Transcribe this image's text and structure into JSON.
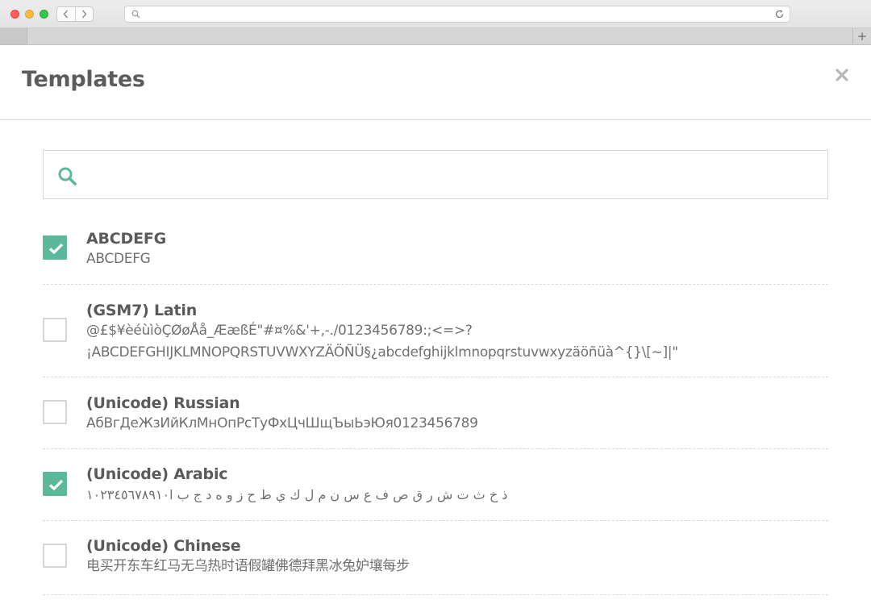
{
  "browser": {
    "back_icon": "chevron-left-icon",
    "forward_icon": "chevron-right-icon",
    "url_value": "",
    "new_tab_label": "+"
  },
  "modal": {
    "title": "Templates",
    "close_icon": "close-icon",
    "search": {
      "icon": "search-icon",
      "value": "",
      "placeholder": ""
    }
  },
  "templates": [
    {
      "name": "ABCDEFG",
      "checked": true,
      "lines": [
        "ABCDEFG"
      ]
    },
    {
      "name": "(GSM7) Latin",
      "checked": false,
      "lines": [
        "@£$¥èéùìòÇØøÅå_ÆæßÉ\"#¤%&'+,-./0123456789:;<=>?",
        "¡ABCDEFGHIJKLMNOPQRSTUVWXYZÄÖÑÜ§¿abcdefghijklmnopqrstuvwxyzäöñüà^{}\\[~]|\""
      ]
    },
    {
      "name": "(Unicode) Russian",
      "checked": false,
      "lines": [
        "АбВгДеЖзИйКлМнОпРсТуФхЦчШщЪыЬэЮя0123456789"
      ]
    },
    {
      "name": "(Unicode) Arabic",
      "checked": true,
      "lines": [
        "ذ خ ث ت ش ر ق ص ف ع س ن م ل ك ي ط ح ز و ه د ج ب ا١٠٢٣٤٥٦٧٨٩١٠"
      ]
    },
    {
      "name": "(Unicode) Chinese",
      "checked": false,
      "lines": [
        "电买开东车红马无乌热时语假罐佛德拜黑冰兔妒壤每步"
      ]
    }
  ],
  "colors": {
    "accent": "#5cb89a",
    "title": "#5c5c5c",
    "text": "#707070"
  }
}
